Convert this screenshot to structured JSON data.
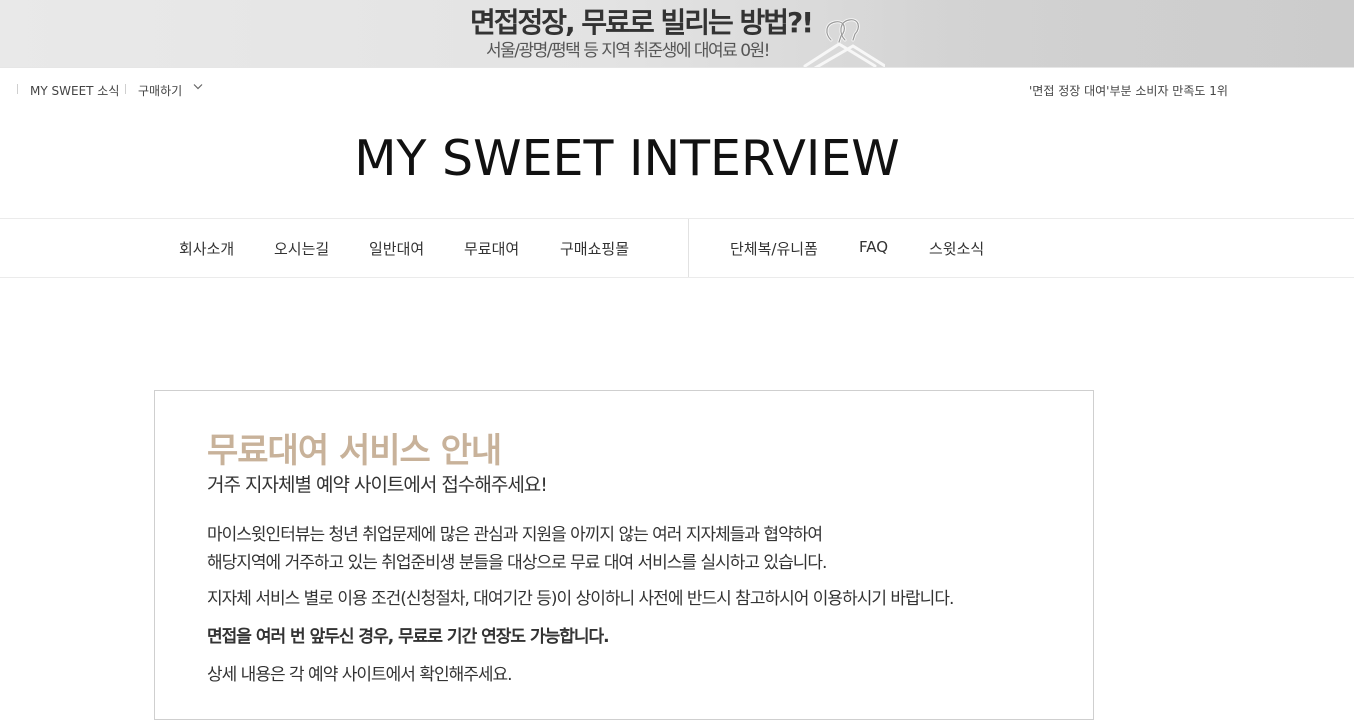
{
  "banner": {
    "title": "면접정장, 무료로 빌리는 방법?!",
    "subtitle": "서울/광명/평택 등 지역 취준생에 대여료 0원!"
  },
  "util": {
    "news_link": "MY SWEET 소식",
    "purchase_link": "구매하기",
    "tagline": "'면접 정장 대여'부분 소비자 만족도 1위"
  },
  "logo": "MY SWEET INTERVIEW",
  "nav": {
    "items": [
      "회사소개",
      "오시는길",
      "일반대여",
      "무료대여",
      "구매쇼핑몰"
    ],
    "items_right": [
      "단체복/유니폼",
      "FAQ",
      "스윗소식"
    ]
  },
  "info": {
    "title": "무료대여 서비스 안내",
    "subtitle": "거주 지자체별 예약 사이트에서 접수해주세요!",
    "line1": "마이스윗인터뷰는 청년 취업문제에 많은 관심과 지원을 아끼지 않는 여러 지자체들과 협약하여",
    "line2": "해당지역에 거주하고 있는 취업준비생 분들을 대상으로 무료 대여 서비스를 실시하고 있습니다.",
    "line3": "지자체 서비스 별로 이용 조건(신청절차, 대여기간 등)이 상이하니 사전에 반드시 참고하시어 이용하시기 바랍니다.",
    "line4": "면접을 여러 번 앞두신 경우, 무료로 기간 연장도 가능합니다.",
    "line5": "상세 내용은 각 예약 사이트에서 확인해주세요."
  },
  "colors": {
    "accent": "#c8b29a",
    "text": "#333333"
  }
}
